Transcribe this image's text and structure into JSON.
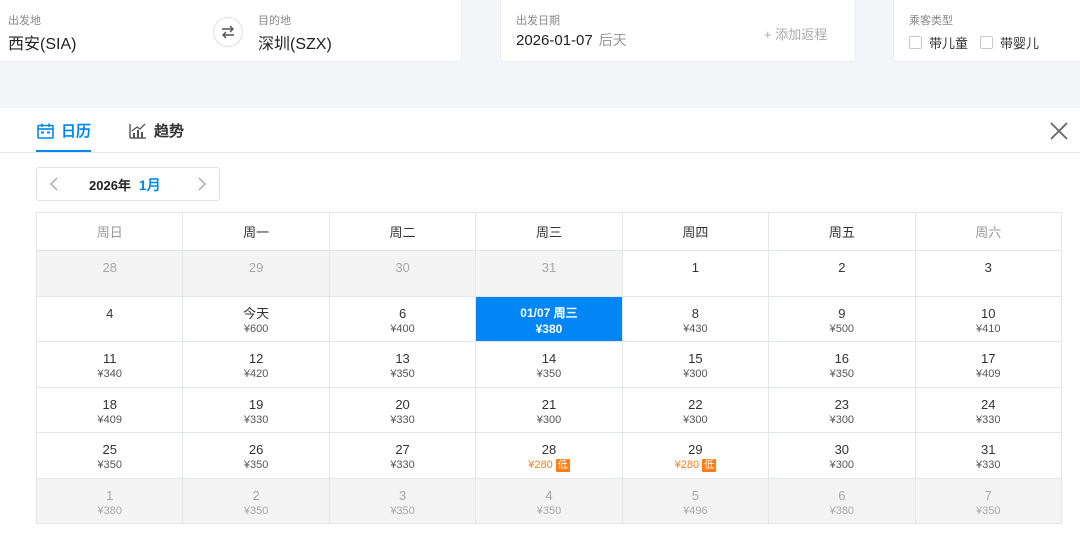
{
  "search": {
    "from_label": "出发地",
    "from_value": "西安(SIA)",
    "to_label": "目的地",
    "to_value": "深圳(SZX)",
    "date_label": "出发日期",
    "date_value": "2026-01-07",
    "date_hint": "后天",
    "add_return": "+ 添加返程",
    "pax_label": "乘客类型",
    "pax_child": "带儿童",
    "pax_infant": "带婴儿"
  },
  "tabs": [
    {
      "label": "日历",
      "icon": "calendar-icon",
      "active": true
    },
    {
      "label": "趋势",
      "icon": "trend-chart-icon",
      "active": false
    }
  ],
  "calendar": {
    "year": "2026年",
    "month": "1月",
    "weekdays": [
      "周日",
      "周一",
      "周二",
      "周三",
      "周四",
      "周五",
      "周六"
    ],
    "weeks": [
      [
        {
          "day": "28",
          "price": "",
          "state": "other"
        },
        {
          "day": "29",
          "price": "",
          "state": "other"
        },
        {
          "day": "30",
          "price": "",
          "state": "other"
        },
        {
          "day": "31",
          "price": "",
          "state": "other"
        },
        {
          "day": "1",
          "price": "",
          "state": "normal"
        },
        {
          "day": "2",
          "price": "",
          "state": "normal"
        },
        {
          "day": "3",
          "price": "",
          "state": "normal"
        }
      ],
      [
        {
          "day": "4",
          "price": "",
          "state": "normal"
        },
        {
          "day": "今天",
          "price": "¥600",
          "state": "normal"
        },
        {
          "day": "6",
          "price": "¥400",
          "state": "normal"
        },
        {
          "day": "01/07 周三",
          "price": "¥380",
          "state": "selected"
        },
        {
          "day": "8",
          "price": "¥430",
          "state": "normal"
        },
        {
          "day": "9",
          "price": "¥500",
          "state": "normal"
        },
        {
          "day": "10",
          "price": "¥410",
          "state": "normal"
        }
      ],
      [
        {
          "day": "11",
          "price": "¥340",
          "state": "normal"
        },
        {
          "day": "12",
          "price": "¥420",
          "state": "normal"
        },
        {
          "day": "13",
          "price": "¥350",
          "state": "normal"
        },
        {
          "day": "14",
          "price": "¥350",
          "state": "normal"
        },
        {
          "day": "15",
          "price": "¥300",
          "state": "normal"
        },
        {
          "day": "16",
          "price": "¥350",
          "state": "normal"
        },
        {
          "day": "17",
          "price": "¥409",
          "state": "normal"
        }
      ],
      [
        {
          "day": "18",
          "price": "¥409",
          "state": "normal"
        },
        {
          "day": "19",
          "price": "¥330",
          "state": "normal"
        },
        {
          "day": "20",
          "price": "¥330",
          "state": "normal"
        },
        {
          "day": "21",
          "price": "¥300",
          "state": "normal"
        },
        {
          "day": "22",
          "price": "¥300",
          "state": "normal"
        },
        {
          "day": "23",
          "price": "¥300",
          "state": "normal"
        },
        {
          "day": "24",
          "price": "¥330",
          "state": "normal"
        }
      ],
      [
        {
          "day": "25",
          "price": "¥350",
          "state": "normal"
        },
        {
          "day": "26",
          "price": "¥350",
          "state": "normal"
        },
        {
          "day": "27",
          "price": "¥330",
          "state": "normal"
        },
        {
          "day": "28",
          "price": "¥280",
          "state": "low",
          "badge": "低"
        },
        {
          "day": "29",
          "price": "¥280",
          "state": "low",
          "badge": "低"
        },
        {
          "day": "30",
          "price": "¥300",
          "state": "normal"
        },
        {
          "day": "31",
          "price": "¥330",
          "state": "normal"
        }
      ],
      [
        {
          "day": "1",
          "price": "¥380",
          "state": "other"
        },
        {
          "day": "2",
          "price": "¥350",
          "state": "other"
        },
        {
          "day": "3",
          "price": "¥350",
          "state": "other"
        },
        {
          "day": "4",
          "price": "¥350",
          "state": "other"
        },
        {
          "day": "5",
          "price": "¥496",
          "state": "other"
        },
        {
          "day": "6",
          "price": "¥380",
          "state": "other"
        },
        {
          "day": "7",
          "price": "¥350",
          "state": "other"
        }
      ]
    ]
  },
  "colors": {
    "accent": "#0086f6",
    "low_price": "#ff7d13",
    "other_month_bg": "#f4f4f5"
  }
}
